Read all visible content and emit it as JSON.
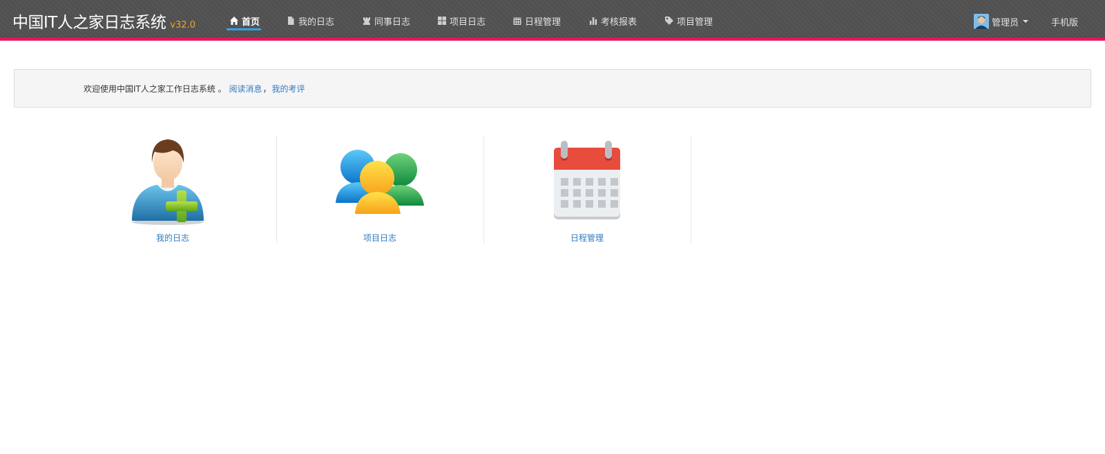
{
  "header": {
    "title": "中国IT人之家日志系统",
    "version": "v32.0",
    "accent_color": "#e8175d",
    "nav": [
      {
        "label": "首页",
        "icon": "home-icon",
        "active": true
      },
      {
        "label": "我的日志",
        "icon": "file-icon",
        "active": false
      },
      {
        "label": "同事日志",
        "icon": "chess-rook-icon",
        "active": false
      },
      {
        "label": "项目日志",
        "icon": "grid-icon",
        "active": false
      },
      {
        "label": "日程管理",
        "icon": "calendar-icon",
        "active": false
      },
      {
        "label": "考核报表",
        "icon": "bar-chart-icon",
        "active": false
      },
      {
        "label": "项目管理",
        "icon": "tag-icon",
        "active": false
      }
    ],
    "user": {
      "name": "管理员",
      "icon": "user-avatar-icon"
    },
    "mobile_label": "手机版"
  },
  "welcome": {
    "text": "欢迎使用中国IT人之家工作日志系统 。",
    "link_read_messages": "阅读消息",
    "separator": "，",
    "link_my_reviews": "我的考评"
  },
  "tiles": [
    {
      "label": "我的日志",
      "icon": "user-add-icon"
    },
    {
      "label": "项目日志",
      "icon": "group-icon"
    },
    {
      "label": "日程管理",
      "icon": "calendar-icon"
    }
  ]
}
